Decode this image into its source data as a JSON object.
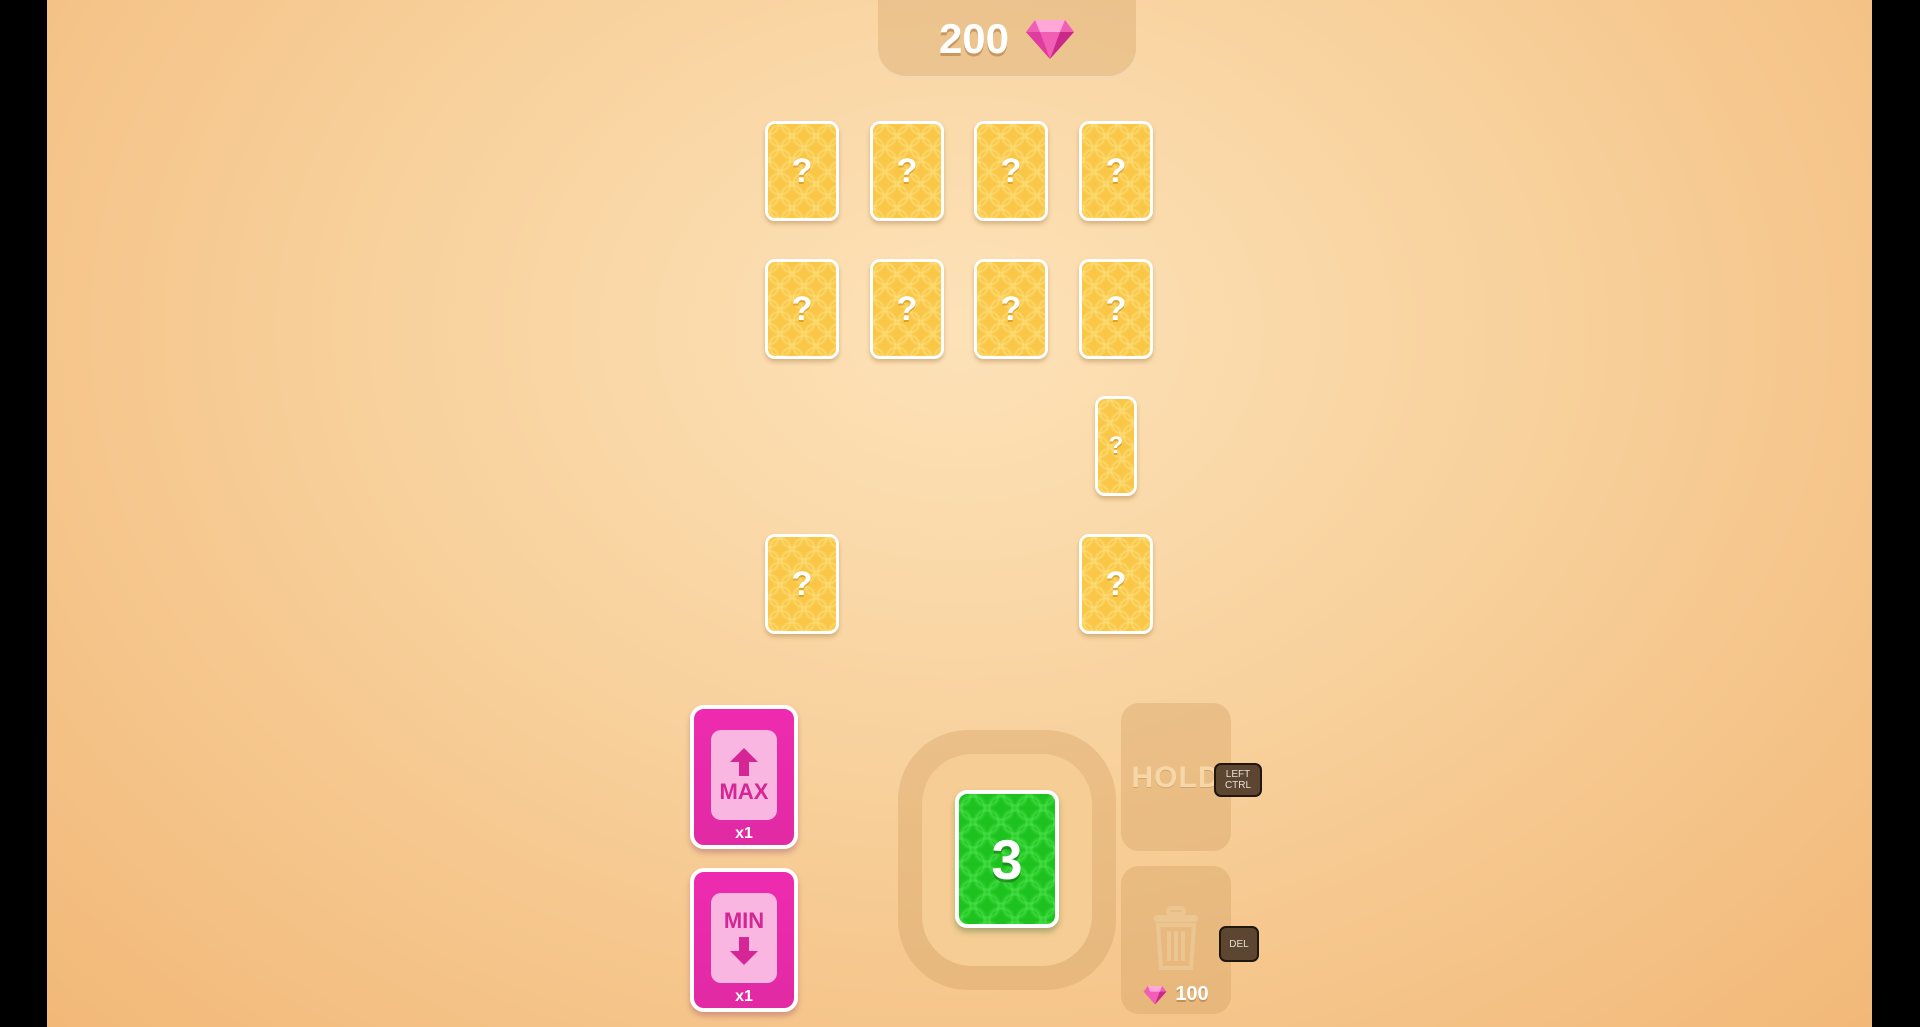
{
  "score": {
    "value": "200",
    "currency_icon": "pink-gem-icon"
  },
  "board": {
    "card_label": "?",
    "cards": [
      {
        "label": "?"
      },
      {
        "label": "?"
      },
      {
        "label": "?"
      },
      {
        "label": "?"
      },
      {
        "label": "?"
      },
      {
        "label": "?"
      },
      {
        "label": "?"
      },
      {
        "label": "?"
      },
      {
        "label": "?"
      },
      {
        "label": "?"
      },
      {
        "label": "?"
      }
    ]
  },
  "powerups": {
    "max": {
      "label": "MAX",
      "count": "x1",
      "icon": "arrow-up-icon"
    },
    "min": {
      "label": "MIN",
      "count": "x1",
      "icon": "arrow-down-icon"
    }
  },
  "deck": {
    "current_card": "3",
    "current_color": "#1ec21e"
  },
  "hold": {
    "label": "HOLD",
    "key_hint": "LEFT CTRL"
  },
  "trash": {
    "key_hint": "DEL",
    "cost": "100",
    "icon": "trash-icon"
  },
  "colors": {
    "card_back": "#f9c646",
    "powerup": "#e12aa4",
    "background": "#f8d19c"
  }
}
